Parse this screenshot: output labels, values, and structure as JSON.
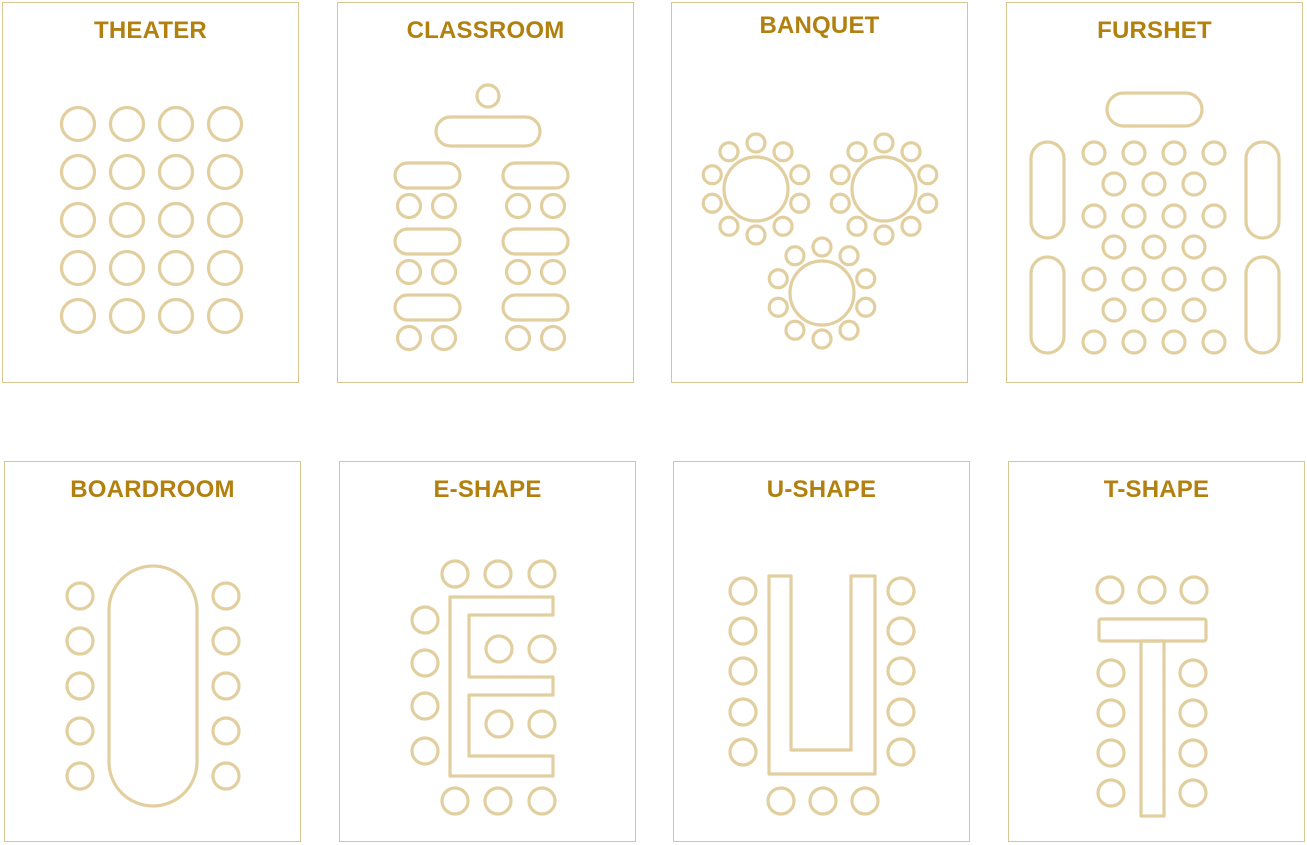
{
  "colors": {
    "title": "#b1800f",
    "stroke": "#e2cf9f",
    "frame": "#d9c591"
  },
  "layouts": [
    {
      "id": "theater",
      "title": "THEATER",
      "icon": "theater-seating-layout"
    },
    {
      "id": "classroom",
      "title": "CLASSROOM",
      "icon": "classroom-seating-layout"
    },
    {
      "id": "banquet",
      "title": "BANQUET",
      "icon": "banquet-seating-layout"
    },
    {
      "id": "furshet",
      "title": "FURSHET",
      "icon": "furshet-seating-layout"
    },
    {
      "id": "boardroom",
      "title": "BOARDROOM",
      "icon": "boardroom-seating-layout"
    },
    {
      "id": "e-shape",
      "title": "E-SHAPE",
      "icon": "e-shape-seating-layout"
    },
    {
      "id": "u-shape",
      "title": "U-SHAPE",
      "icon": "u-shape-seating-layout"
    },
    {
      "id": "t-shape",
      "title": "T-SHAPE",
      "icon": "t-shape-seating-layout"
    }
  ]
}
